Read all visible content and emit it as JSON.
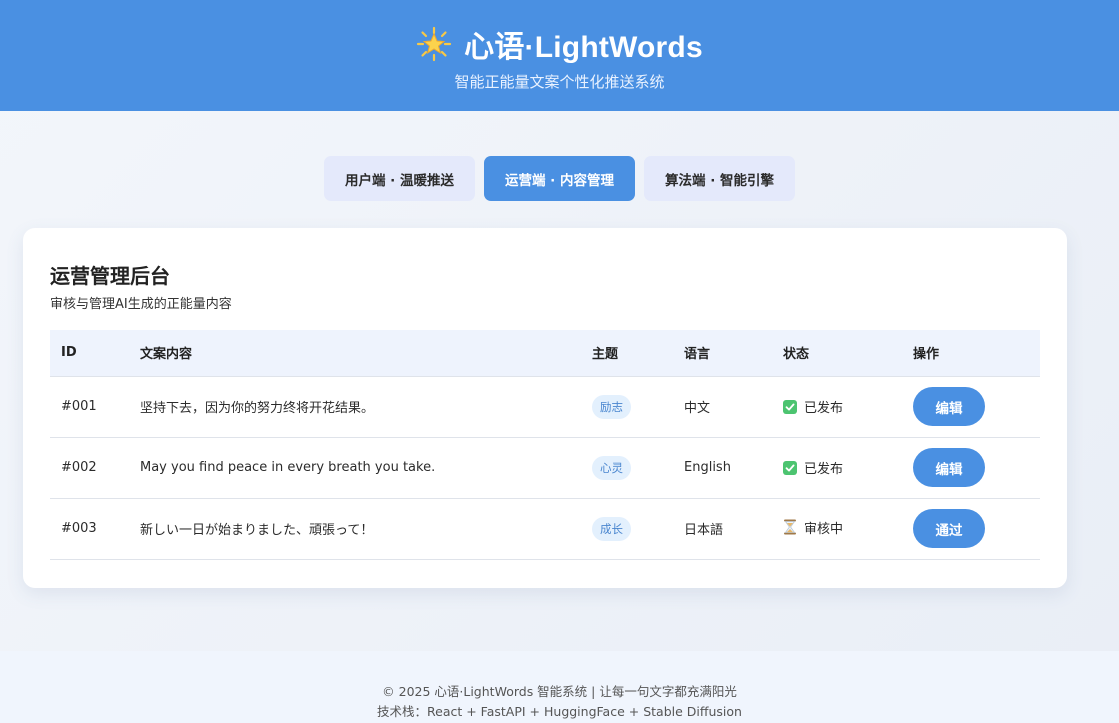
{
  "header": {
    "title": "心语·LightWords",
    "subtitle": "智能正能量文案个性化推送系统",
    "icon": "star-icon"
  },
  "tabs": [
    {
      "label": "用户端 · 温暖推送",
      "active": false
    },
    {
      "label": "运营端 · 内容管理",
      "active": true
    },
    {
      "label": "算法端 · 智能引擎",
      "active": false
    }
  ],
  "panel": {
    "title": "运营管理后台",
    "subtitle": "审核与管理AI生成的正能量内容"
  },
  "table": {
    "headers": {
      "id": "ID",
      "text": "文案内容",
      "topic": "主题",
      "lang": "语言",
      "status": "状态",
      "action": "操作"
    },
    "rows": [
      {
        "id": "#001",
        "text": "坚持下去，因为你的努力终将开花结果。",
        "topic": "励志",
        "lang": "中文",
        "status": "已发布",
        "status_icon": "check-icon",
        "action": "编辑"
      },
      {
        "id": "#002",
        "text": "May you find peace in every breath you take.",
        "topic": "心灵",
        "lang": "English",
        "status": "已发布",
        "status_icon": "check-icon",
        "action": "编辑"
      },
      {
        "id": "#003",
        "text": "新しい一日が始まりました、頑張って！",
        "topic": "成长",
        "lang": "日本語",
        "status": "审核中",
        "status_icon": "hourglass-icon",
        "action": "通过"
      }
    ]
  },
  "footer": {
    "line1": "© 2025 心语·LightWords 智能系统 | 让每一句文字都充满阳光",
    "line2": "技术栈：React + FastAPI + HuggingFace + Stable Diffusion"
  },
  "colors": {
    "primary": "#4a90e2",
    "tab_inactive": "#e4e9fb",
    "badge_bg": "#e3f0fd",
    "success": "#4cc470"
  }
}
